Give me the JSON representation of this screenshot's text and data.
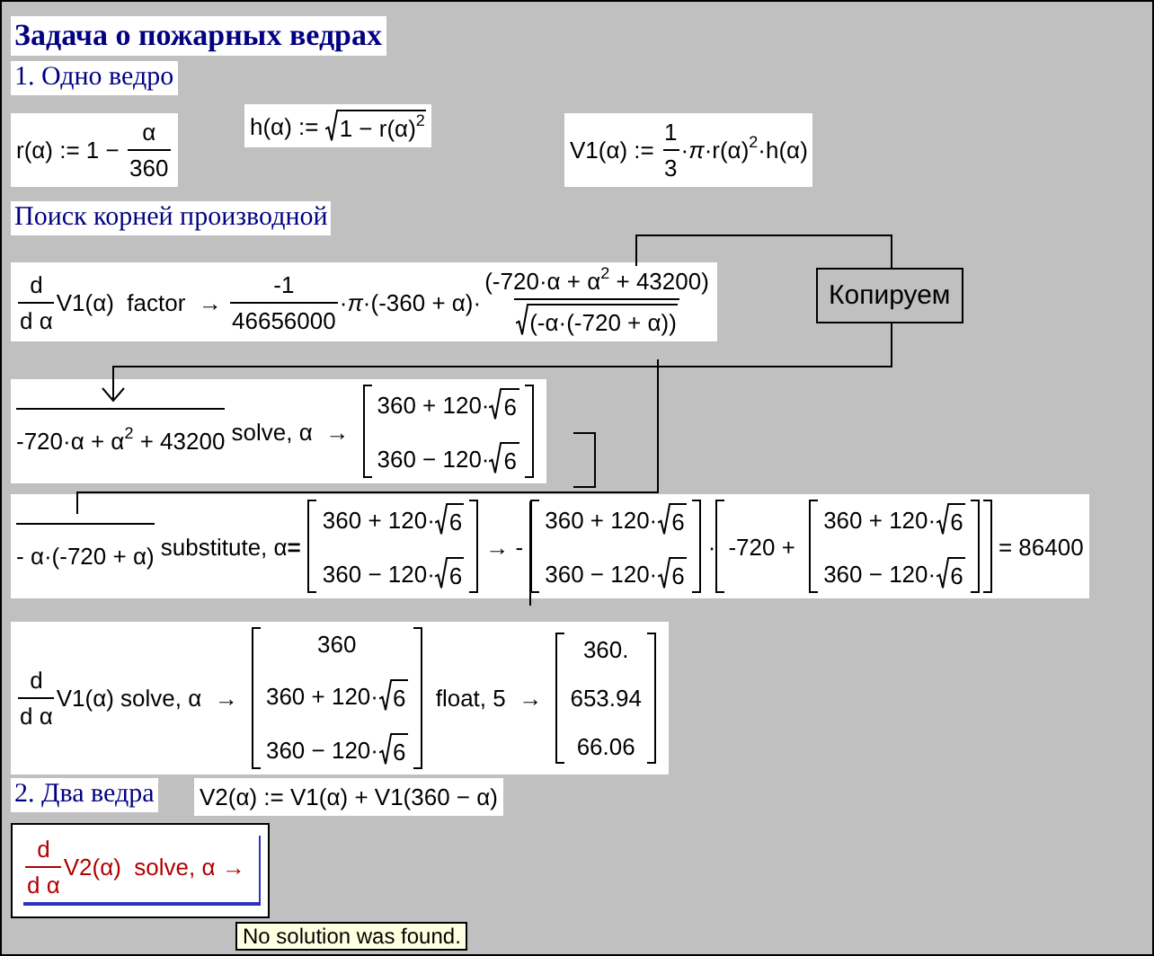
{
  "worksheet": {
    "regions": [
      {
        "kind": "title",
        "text": "Задача о пожарных ведрах"
      },
      {
        "kind": "heading",
        "text": "1. Одно ведро"
      },
      {
        "kind": "math",
        "error": false,
        "content": [
          "r(α) := 1 − ",
          {
            "kind": "frac",
            "num": [
              "α"
            ],
            "den": [
              "360"
            ]
          }
        ]
      },
      {
        "kind": "math",
        "error": false,
        "content": [
          "h(α) := ",
          {
            "kind": "sqrt",
            "body": [
              "1 − r(α)$^{2}$"
            ]
          }
        ]
      },
      {
        "kind": "math",
        "error": false,
        "content": [
          "V1(α) := ",
          {
            "kind": "frac",
            "num": [
              "1"
            ],
            "den": [
              "3"
            ]
          },
          "·*π*·r(α)$^{2}$·h(α)"
        ]
      },
      {
        "kind": "heading",
        "text": "Поиск корней производной"
      },
      {
        "kind": "math",
        "error": false,
        "content": [
          {
            "kind": "frac",
            "num": [
              "d"
            ],
            "den": [
              "d α"
            ]
          },
          "V1(α)  factor  → ",
          {
            "kind": "frac",
            "num": [
              "-1"
            ],
            "den": [
              "46656000"
            ]
          },
          "·*π*·(-360 + α)·",
          {
            "kind": "frac",
            "num": [
              "(-720·α + α$^{2}$ + 43200)"
            ],
            "den": [
              {
                "kind": "sqrt",
                "body": [
                  "(-α·(-720 + α))"
                ]
              }
            ]
          }
        ]
      },
      {
        "kind": "callout",
        "text": "Копируем"
      },
      {
        "kind": "math",
        "error": false,
        "content": [
          {
            "kind": "overline",
            "body": [
              "-720·α + α$^{2}$ + 43200"
            ]
          },
          " solve, α  → ",
          {
            "kind": "matrix",
            "rows": [
              [
                "360 + 120·",
                {
                  "kind": "sqrt",
                  "body": [
                    "6"
                  ]
                }
              ],
              [
                "360 − 120·",
                {
                  "kind": "sqrt",
                  "body": [
                    "6"
                  ]
                }
              ]
            ]
          }
        ]
      },
      {
        "kind": "math",
        "error": false,
        "content": [
          {
            "kind": "overline",
            "body": [
              "- α·(-720 + α)"
            ]
          },
          " substitute, α**=**",
          {
            "kind": "matrix",
            "rows": [
              [
                "360 + 120·",
                {
                  "kind": "sqrt",
                  "body": [
                    "6"
                  ]
                }
              ],
              [
                "360 − 120·",
                {
                  "kind": "sqrt",
                  "body": [
                    "6"
                  ]
                }
              ]
            ]
          },
          "→ -",
          {
            "kind": "matrix",
            "rows": [
              [
                "360 + 120·",
                {
                  "kind": "sqrt",
                  "body": [
                    "6"
                  ]
                }
              ],
              [
                "360 − 120·",
                {
                  "kind": "sqrt",
                  "body": [
                    "6"
                  ]
                }
              ]
            ]
          },
          "·",
          {
            "kind": "bracket",
            "body": [
              "-720 + ",
              {
                "kind": "matrix",
                "rows": [
                  [
                    "360 + 120·",
                    {
                      "kind": "sqrt",
                      "body": [
                        "6"
                      ]
                    }
                  ],
                  [
                    "360 − 120·",
                    {
                      "kind": "sqrt",
                      "body": [
                        "6"
                      ]
                    }
                  ]
                ]
              }
            ]
          },
          " = 86400"
        ]
      },
      {
        "kind": "math",
        "error": false,
        "content": [
          {
            "kind": "frac",
            "num": [
              "d"
            ],
            "den": [
              "d α"
            ]
          },
          "V1(α) solve, α  → ",
          {
            "kind": "matrix",
            "rows": [
              [
                "360"
              ],
              [
                "360 + 120·",
                {
                  "kind": "sqrt",
                  "body": [
                    "6"
                  ]
                }
              ],
              [
                "360 − 120·",
                {
                  "kind": "sqrt",
                  "body": [
                    "6"
                  ]
                }
              ]
            ]
          },
          " float, 5  → ",
          {
            "kind": "matrix",
            "rows": [
              [
                "360."
              ],
              [
                "653.94"
              ],
              [
                "66.06"
              ]
            ]
          }
        ]
      },
      {
        "kind": "heading",
        "text": "2. Два ведра"
      },
      {
        "kind": "math",
        "error": false,
        "content": [
          "V2(α) := V1(α) + V1(360 − α)"
        ]
      },
      {
        "kind": "math",
        "error": true,
        "content": [
          {
            "kind": "frac",
            "num": [
              "d"
            ],
            "den": [
              "d α"
            ]
          },
          "V2(α)  solve, α →"
        ]
      }
    ],
    "tooltip": "No solution was found."
  }
}
